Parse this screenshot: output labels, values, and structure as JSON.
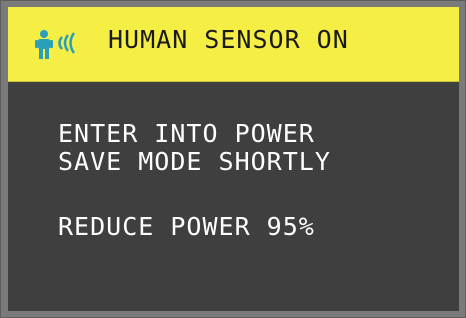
{
  "banner": {
    "icon": "human-sensor-icon",
    "text": "HUMAN SENSOR ON",
    "background_color": "#f5ee45",
    "icon_color": "#2a9fb8"
  },
  "message": {
    "line1": "ENTER INTO POWER",
    "line2": "SAVE MODE SHORTLY",
    "line3": "REDUCE POWER 95%"
  },
  "colors": {
    "panel": "#3f3f3f",
    "frame": "#7a7a7a",
    "text": "#ffffff"
  }
}
